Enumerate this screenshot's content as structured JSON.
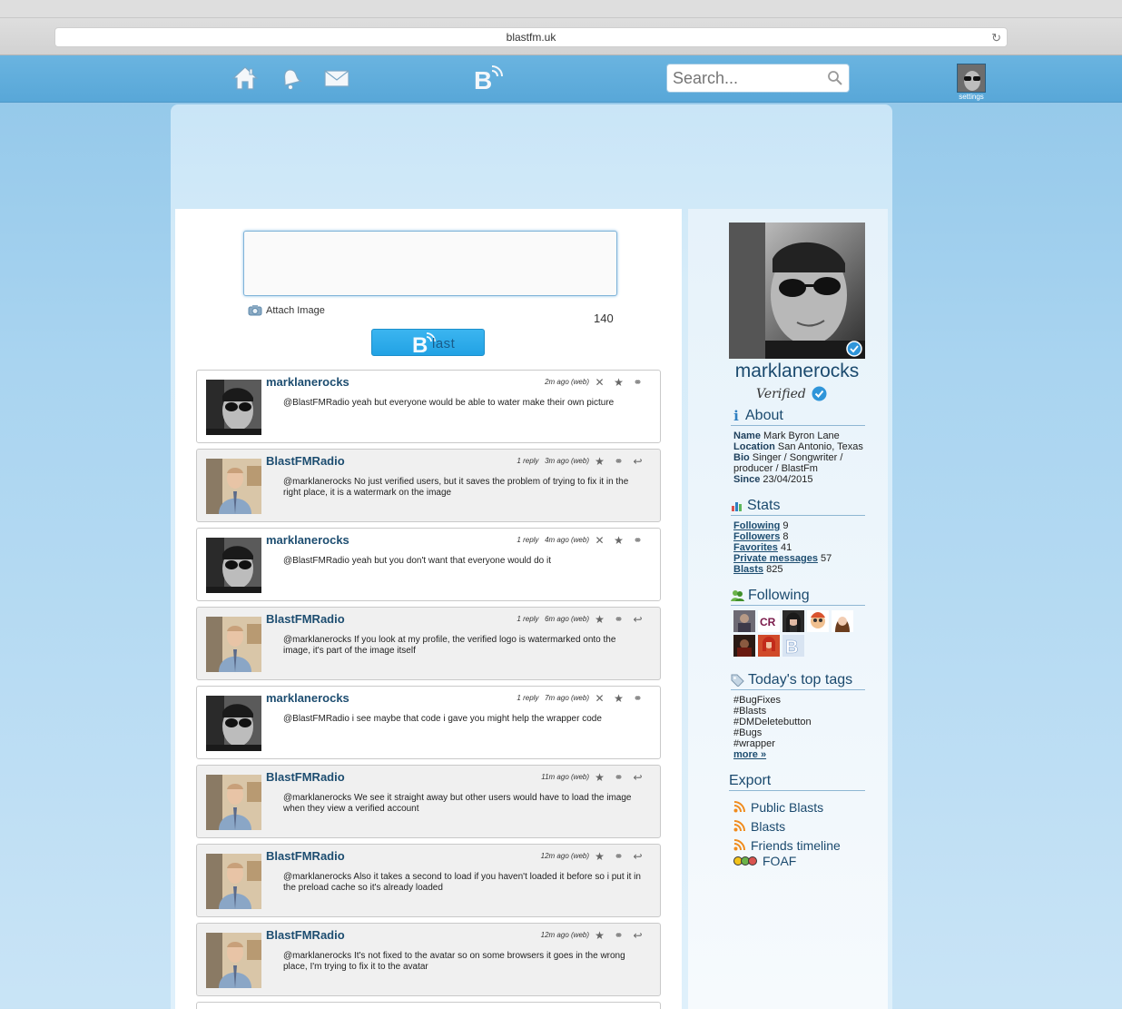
{
  "browser": {
    "url": "blastfm.uk"
  },
  "header": {
    "search_placeholder": "Search...",
    "settings_label": "settings"
  },
  "composer": {
    "attach_label": "Attach Image",
    "counter": "140",
    "blast_label": "last"
  },
  "feed": [
    {
      "user": "marklanerocks",
      "own": true,
      "reply": "",
      "time": "2m ago",
      "source": "(web)",
      "message": "@BlastFMRadio yeah but everyone would be able to water make their own picture"
    },
    {
      "user": "BlastFMRadio",
      "own": false,
      "reply": "1 reply",
      "time": "3m ago",
      "source": "(web)",
      "message": "@marklanerocks No just verified users, but it saves the problem of trying to fix it in the right place, it is a watermark on the image"
    },
    {
      "user": "marklanerocks",
      "own": true,
      "reply": "1 reply",
      "time": "4m ago",
      "source": "(web)",
      "message": "@BlastFMRadio yeah but you don't want that everyone would do it"
    },
    {
      "user": "BlastFMRadio",
      "own": false,
      "reply": "1 reply",
      "time": "6m ago",
      "source": "(web)",
      "message": "@marklanerocks If you look at my profile, the verified logo is watermarked onto the image, it's part of the image itself"
    },
    {
      "user": "marklanerocks",
      "own": true,
      "reply": "1 reply",
      "time": "7m ago",
      "source": "(web)",
      "message": "@BlastFMRadio i see maybe that code i gave you might help the wrapper code"
    },
    {
      "user": "BlastFMRadio",
      "own": false,
      "reply": "",
      "time": "11m ago",
      "source": "(web)",
      "message": "@marklanerocks We see it straight away but other users would have to load the image when they view a verified account"
    },
    {
      "user": "BlastFMRadio",
      "own": false,
      "reply": "",
      "time": "12m ago",
      "source": "(web)",
      "message": "@marklanerocks Also it takes a second to load if you haven't loaded it before so i put it in the preload cache so it's already loaded"
    },
    {
      "user": "BlastFMRadio",
      "own": false,
      "reply": "",
      "time": "12m ago",
      "source": "(web)",
      "message": "@marklanerocks It's not fixed to the avatar so on some browsers it goes in the wrong place, I'm trying to fix it to the avatar"
    }
  ],
  "profile": {
    "username": "marklanerocks",
    "verified_label": "Verified",
    "about_title": "About",
    "about": {
      "name_label": "Name",
      "name": "Mark Byron Lane",
      "location_label": "Location",
      "location": "San Antonio, Texas",
      "bio_label": "Bio",
      "bio": "Singer / Songwriter / producer / BlastFm",
      "since_label": "Since",
      "since": "23/04/2015"
    },
    "stats_title": "Stats",
    "stats": [
      {
        "label": "Following",
        "value": "9"
      },
      {
        "label": "Followers",
        "value": "8"
      },
      {
        "label": "Favorites",
        "value": "41"
      },
      {
        "label": "Private messages",
        "value": "57"
      },
      {
        "label": "Blasts",
        "value": "825"
      }
    ],
    "following_title": "Following",
    "tags_title": "Today's top tags",
    "tags": [
      "#BugFixes",
      "#Blasts",
      "#DMDeletebutton",
      "#Bugs",
      "#wrapper"
    ],
    "tags_more": "more »",
    "export_title": "Export",
    "export": [
      "Public Blasts",
      "Blasts",
      "Friends timeline",
      "FOAF"
    ]
  },
  "colors": {
    "header": "#5aa8d9",
    "accent": "#22a2e4",
    "link": "#1d4d70"
  }
}
